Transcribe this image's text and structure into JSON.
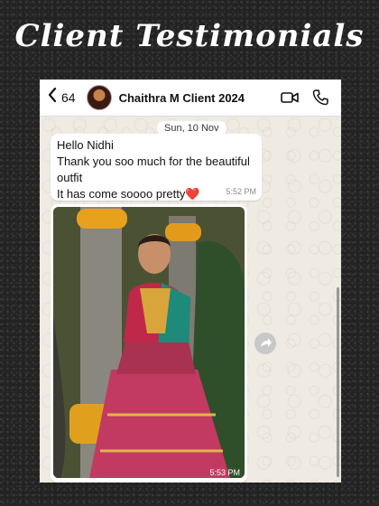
{
  "page": {
    "headline": "Client Testimonials"
  },
  "chat_header": {
    "back_count": "64",
    "contact_name": "Chaithra M Client 2024"
  },
  "chat": {
    "date_chip": "Sun, 10 Nov",
    "messages": [
      {
        "lines": [
          "Hello Nidhi",
          "Thank you soo much for the beautiful",
          "outfit",
          "It has come soooo pretty"
        ],
        "emoji": "❤️",
        "time": "5:52 PM"
      },
      {
        "type": "photo",
        "time": "5:53 PM"
      }
    ]
  },
  "icons": {
    "back": "chevron-left-icon",
    "video": "video-camera-icon",
    "call": "phone-icon",
    "forward": "forward-icon"
  },
  "colors": {
    "chat_background": "#efeae2",
    "bubble": "#ffffff",
    "page_background": "#222222",
    "heart": "#e0245e"
  }
}
